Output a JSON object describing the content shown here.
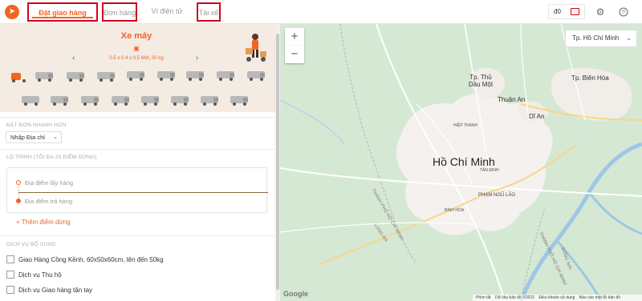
{
  "header": {
    "tabs": [
      {
        "label": "Đặt giao hàng"
      },
      {
        "label": "Đơn hàng"
      },
      {
        "label": "Ví điện tử"
      },
      {
        "label": "Tài xế"
      }
    ],
    "wallet_label": "đ0"
  },
  "vehicle": {
    "title": "Xe máy",
    "desc": "0.5 x 0.4 x 0.5 Mét, 30 kg"
  },
  "quick": {
    "label": "ĐẶT ĐƠN NHANH HƠN",
    "select": "Nhập Địa chỉ"
  },
  "route": {
    "label": "LỘ TRÌNH (TỐI ĐA 20 ĐIỂM DỪNG)",
    "pickup_placeholder": "Địa điểm lấy hàng",
    "dropoff_placeholder": "Địa điểm trả hàng",
    "add_stop": "+ Thêm điểm dừng"
  },
  "services": {
    "label": "DỊCH VỤ BỔ SUNG",
    "items": [
      "Giao Hàng Cồng Kềnh, 60x50x60cm, lên đến 50kg",
      "Dịch vụ Thu hộ",
      "Dịch vụ Giao hàng tận tay"
    ]
  },
  "map": {
    "city_select": "Tp. Hồ Chí Minh",
    "labels": {
      "hcm": "Hồ Chí Minh",
      "thu_dau_mot": "Tp. Thủ Dầu Một",
      "bien_hoa": "Tp. Biên Hòa",
      "thuan_an": "Thuận An",
      "di_an": "Dĩ An",
      "pham_ngu_lao": "PHẠM NGŨ LÃO",
      "long_an": "LONG AN",
      "tp_hcm_road": "THÀNH PHỐ HỒ CHÍ MINH",
      "tp_hcm_road2": "THÀNH PHỐ HỒ CHÍ MINH",
      "dong_nai": "ĐỒNG NAI",
      "hiep_thanh": "HIỆP THÀNH",
      "tan_dinh": "TÂN ĐỊNH",
      "binh_hoa": "BÌNH HÒA"
    },
    "footer": {
      "shortcuts": "Phím tắt",
      "data": "Dữ liệu bản đồ ©2022",
      "terms": "Điều khoản sử dụng",
      "report": "Báo cáo một lỗi bản đồ"
    },
    "google": "Google"
  }
}
